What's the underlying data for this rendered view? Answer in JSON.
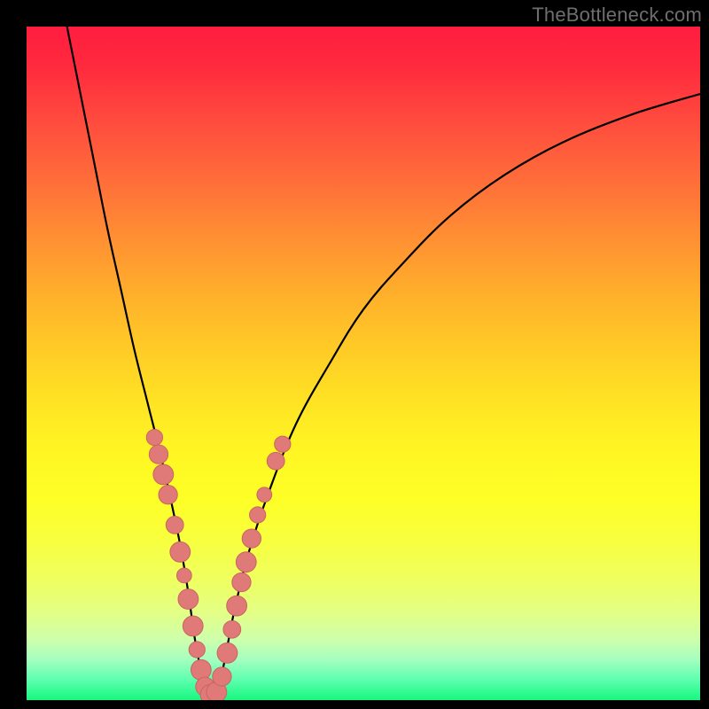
{
  "watermark": "TheBottleneck.com",
  "colors": {
    "curve_stroke": "#000000",
    "marker_fill": "#e07a78",
    "marker_stroke": "#c96460",
    "background": "#000000"
  },
  "chart_data": {
    "type": "line",
    "title": "",
    "xlabel": "",
    "ylabel": "",
    "xlim": [
      0,
      100
    ],
    "ylim": [
      0,
      100
    ],
    "x_ticks": [],
    "y_ticks": [],
    "note": "Axes are unlabeled; x/y expressed as percent of plot width/height with origin at bottom-left. y≈100 = worst (red), y≈0 = best (green). Curve is a V-shaped bottleneck profile with minimum near x≈27.",
    "series": [
      {
        "name": "bottleneck-curve",
        "x": [
          6,
          8,
          10,
          12,
          14,
          16,
          18,
          20,
          22,
          23,
          24,
          25,
          26,
          27,
          28,
          29,
          30,
          31,
          33,
          36,
          40,
          45,
          50,
          56,
          63,
          71,
          80,
          90,
          100
        ],
        "y": [
          100,
          90,
          80,
          70,
          61,
          52,
          44,
          36,
          27,
          22,
          16,
          9,
          4,
          1,
          1,
          4,
          9,
          14,
          22,
          31,
          41,
          50,
          58,
          65,
          72,
          78,
          83,
          87,
          90
        ]
      }
    ],
    "markers": [
      {
        "x": 19.0,
        "y": 39.0,
        "r": 1.2
      },
      {
        "x": 19.6,
        "y": 36.5,
        "r": 1.4
      },
      {
        "x": 20.3,
        "y": 33.5,
        "r": 1.5
      },
      {
        "x": 21.0,
        "y": 30.5,
        "r": 1.4
      },
      {
        "x": 22.0,
        "y": 26.0,
        "r": 1.3
      },
      {
        "x": 22.8,
        "y": 22.0,
        "r": 1.5
      },
      {
        "x": 23.4,
        "y": 18.5,
        "r": 1.1
      },
      {
        "x": 24.0,
        "y": 15.0,
        "r": 1.5
      },
      {
        "x": 24.7,
        "y": 11.0,
        "r": 1.5
      },
      {
        "x": 25.3,
        "y": 7.5,
        "r": 1.2
      },
      {
        "x": 25.9,
        "y": 4.5,
        "r": 1.5
      },
      {
        "x": 26.5,
        "y": 2.0,
        "r": 1.4
      },
      {
        "x": 27.3,
        "y": 0.8,
        "r": 1.5
      },
      {
        "x": 28.2,
        "y": 1.2,
        "r": 1.5
      },
      {
        "x": 29.0,
        "y": 3.5,
        "r": 1.4
      },
      {
        "x": 29.8,
        "y": 7.0,
        "r": 1.5
      },
      {
        "x": 30.5,
        "y": 10.5,
        "r": 1.3
      },
      {
        "x": 31.2,
        "y": 14.0,
        "r": 1.5
      },
      {
        "x": 31.9,
        "y": 17.5,
        "r": 1.4
      },
      {
        "x": 32.6,
        "y": 20.5,
        "r": 1.5
      },
      {
        "x": 33.4,
        "y": 24.0,
        "r": 1.4
      },
      {
        "x": 34.3,
        "y": 27.5,
        "r": 1.2
      },
      {
        "x": 35.3,
        "y": 30.5,
        "r": 1.1
      },
      {
        "x": 37.0,
        "y": 35.5,
        "r": 1.3
      },
      {
        "x": 38.0,
        "y": 38.0,
        "r": 1.2
      }
    ]
  }
}
